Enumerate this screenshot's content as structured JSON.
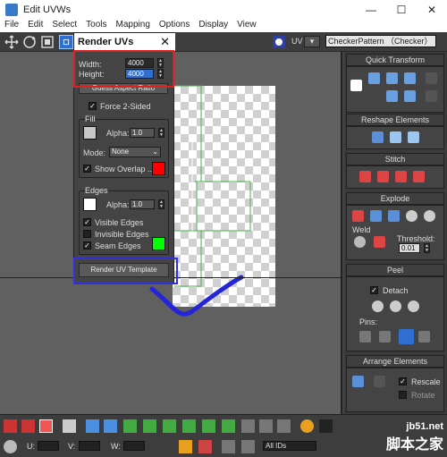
{
  "window": {
    "title": "Edit UVWs",
    "minimize": "—",
    "maximize": "☐",
    "close": "✕"
  },
  "menu": [
    "File",
    "Edit",
    "Select",
    "Tools",
    "Mapping",
    "Options",
    "Display",
    "View"
  ],
  "toolbar": {
    "uv_label": "UV",
    "texture_select": "CheckerPattern （Checker）"
  },
  "dialog": {
    "title": "Render UVs",
    "close": "✕",
    "width_label": "Width:",
    "width_value": "4000",
    "height_label": "Height:",
    "height_value": "4000",
    "guess_button": "Guess Aspect Ratio",
    "force_two_sided": "Force 2-Sided",
    "fill": {
      "title": "Fill",
      "alpha_label": "Alpha:",
      "alpha_value": "1.0",
      "mode_label": "Mode:",
      "mode_value": "None",
      "show_overlap": "Show Overlap ..."
    },
    "edges": {
      "title": "Edges",
      "alpha_label": "Alpha:",
      "alpha_value": "1.0",
      "visible_edges": "Visible Edges",
      "invisible_edges": "Invisible Edges",
      "seam_edges": "Seam Edges"
    },
    "render_button": "Render UV Template"
  },
  "right_panel": {
    "quick_transform": "Quick Transform",
    "reshape_elements": "Reshape Elements",
    "stitch": "Stitch",
    "explode": "Explode",
    "weld_label": "Weld",
    "threshold_label": "Threshold:",
    "threshold_value": "0.01",
    "peel": "Peel",
    "detach_label": "Detach",
    "pins_label": "Pins:",
    "arrange_elements": "Arrange Elements",
    "rescale_label": "Rescale",
    "rotate_label": "Rotate"
  },
  "bottom": {
    "u_label": "U:",
    "v_label": "V:",
    "w_label": "W:",
    "all_ids": "All IDs"
  },
  "watermark": {
    "line1": "jb51.net",
    "line2": "脚本之家"
  },
  "colors": {
    "overlap_swatch": "#ff0000",
    "seam_swatch": "#00ff00",
    "annotation_red": "#e02020",
    "annotation_blue": "#3030e0",
    "accent": "#2f6fd1"
  }
}
